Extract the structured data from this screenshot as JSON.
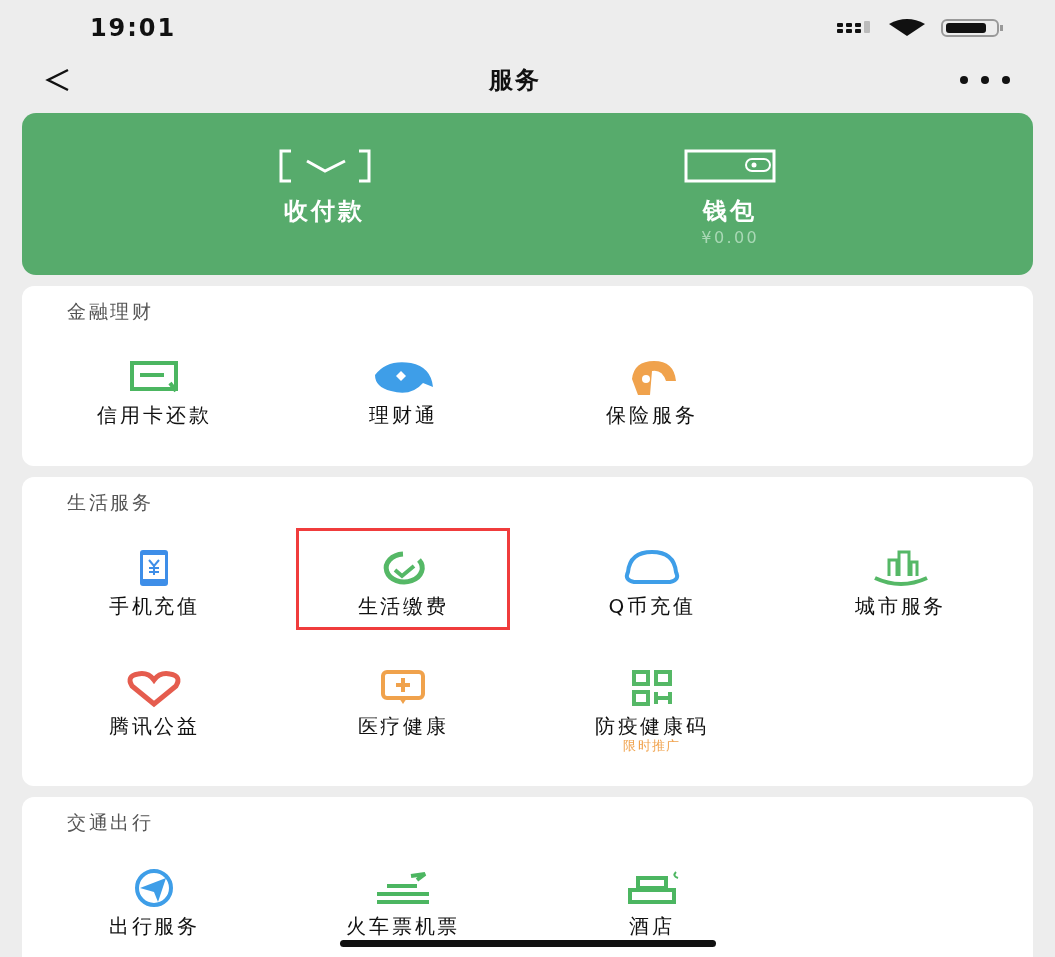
{
  "status_bar": {
    "time": "19:01"
  },
  "nav": {
    "title": "服务"
  },
  "wallet_card": {
    "actions": [
      {
        "label": "收付款"
      },
      {
        "label": "钱包",
        "balance": "¥0.00"
      }
    ]
  },
  "sections": [
    {
      "title": "金融理财",
      "items": [
        {
          "label": "信用卡还款",
          "highlighted": false
        },
        {
          "label": "理财通",
          "highlighted": false
        },
        {
          "label": "保险服务",
          "highlighted": false
        }
      ]
    },
    {
      "title": "生活服务",
      "items": [
        {
          "label": "手机充值",
          "highlighted": false
        },
        {
          "label": "生活缴费",
          "highlighted": true
        },
        {
          "label": "Q币充值",
          "highlighted": false
        },
        {
          "label": "城市服务",
          "highlighted": false
        },
        {
          "label": "腾讯公益",
          "highlighted": false
        },
        {
          "label": "医疗健康",
          "highlighted": false
        },
        {
          "label": "防疫健康码",
          "highlighted": false,
          "note": "限时推广"
        }
      ]
    },
    {
      "title": "交通出行",
      "items": [
        {
          "label": "出行服务",
          "highlighted": false
        },
        {
          "label": "火车票机票",
          "highlighted": false
        },
        {
          "label": "酒店",
          "highlighted": false
        }
      ]
    }
  ]
}
